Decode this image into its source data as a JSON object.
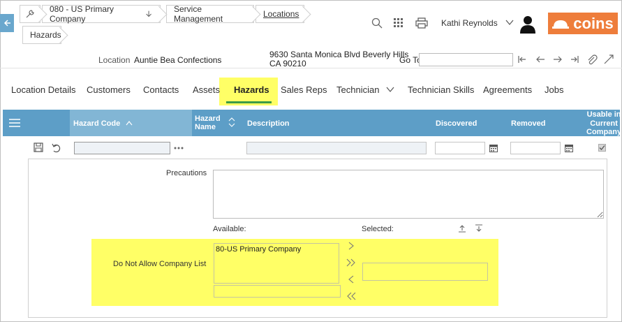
{
  "breadcrumb": {
    "company": "080 - US Primary Company",
    "module": "Service Management",
    "locations": "Locations",
    "current": "Hazards"
  },
  "header": {
    "user_name": "Kathi Reynolds",
    "logo_text": "coins",
    "logo_color": "#ee7d3b"
  },
  "location": {
    "label": "Location",
    "name": "Auntie Bea Confections",
    "address_line1": "9630 Santa Monica Blvd Beverly Hills",
    "address_line2": "CA 90210",
    "goto_label": "Go To",
    "goto_value": ""
  },
  "tabs": [
    {
      "label": "Location Details"
    },
    {
      "label": "Customers"
    },
    {
      "label": "Contacts"
    },
    {
      "label": "Assets"
    },
    {
      "label": "Hazards",
      "active": true
    },
    {
      "label": "Sales Reps"
    },
    {
      "label": "Technician"
    },
    {
      "label": "Technician Skills"
    },
    {
      "label": "Agreements"
    },
    {
      "label": "Jobs"
    }
  ],
  "grid": {
    "columns": {
      "hazard_code": "Hazard Code",
      "hazard_name_1": "Hazard",
      "hazard_name_2": "Name",
      "description": "Description",
      "discovered": "Discovered",
      "removed": "Removed",
      "usable_1": "Usable in",
      "usable_2": "Current",
      "usable_3": "Company"
    },
    "row": {
      "hazard_code": "",
      "description": "",
      "discovered": "",
      "removed": "",
      "usable_checked": true
    },
    "header_color": "#5d9ec7"
  },
  "detail": {
    "precautions_label": "Precautions",
    "precautions_value": "",
    "available_label": "Available:",
    "selected_label": "Selected:",
    "do_not_allow_label": "Do Not Allow Company List",
    "available_items": [
      "80-US Primary Company"
    ],
    "selected_items": [],
    "highlight_color": "#ffff66"
  }
}
